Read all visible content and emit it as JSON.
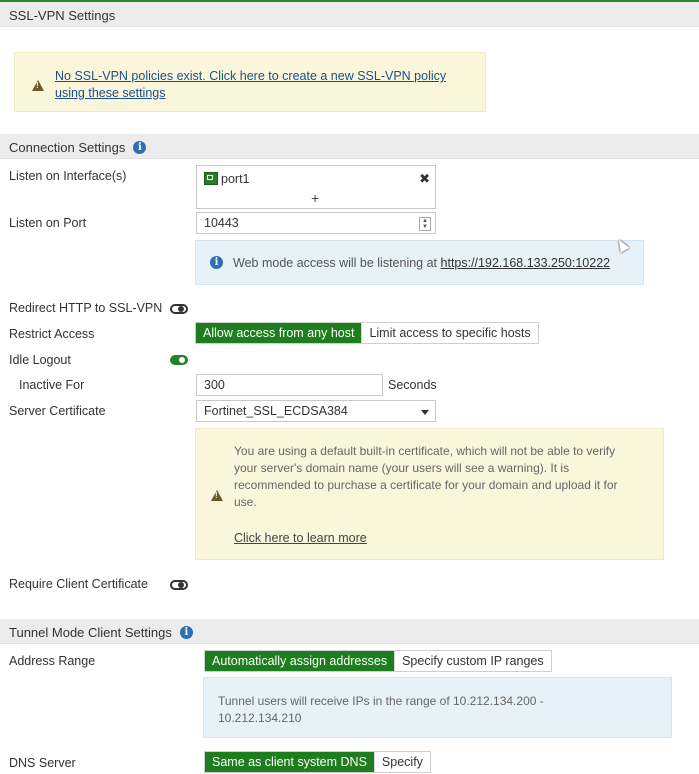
{
  "page": {
    "section_ssl": "SSL-VPN Settings",
    "policy_warning_line1": "No SSL-VPN policies exist. Click here to create a new SSL-VPN policy",
    "policy_warning_line2": "using these settings",
    "section_connection": "Connection Settings",
    "section_tunnel": "Tunnel Mode Client Settings"
  },
  "connection": {
    "listen_interface_label": "Listen on Interface(s)",
    "interface_item": "port1",
    "add_symbol": "+",
    "remove_symbol": "✖",
    "listen_port_label": "Listen on Port",
    "listen_port_value": "10443",
    "web_mode_text": "Web mode access will be listening at ",
    "web_mode_link": "https://192.168.133.250:10222",
    "redirect_label": "Redirect HTTP to SSL-VPN",
    "redirect_on": false,
    "restrict_label": "Restrict Access",
    "restrict_options": [
      "Allow access from any host",
      "Limit access to specific hosts"
    ],
    "idle_logout_label": "Idle Logout",
    "idle_logout_on": true,
    "inactive_for_label": "Inactive For",
    "inactive_for_value": "300",
    "inactive_for_unit": "Seconds",
    "server_cert_label": "Server Certificate",
    "server_cert_value": "Fortinet_SSL_ECDSA384",
    "cert_warning_line1": "You are using a default built-in certificate, which will not be able to verify",
    "cert_warning_line2": "your server's domain name (your users will see a warning). It is",
    "cert_warning_line3": "recommended to purchase a certificate for your domain and upload it for",
    "cert_warning_line4": "use.",
    "learn_more": "Click here to learn more",
    "require_cert_label": "Require Client Certificate",
    "require_cert_on": false
  },
  "tunnel": {
    "address_range_label": "Address Range",
    "address_range_options": [
      "Automatically assign addresses",
      "Specify custom IP ranges"
    ],
    "range_info_line1": "Tunnel users will receive IPs in the range of 10.212.134.200 -",
    "range_info_line2": "10.212.134.210",
    "dns_label": "DNS Server",
    "dns_options": [
      "Same as client system DNS",
      "Specify"
    ]
  },
  "colors": {
    "accent_green": "#1e7d1e",
    "info_blue": "#2b6fb4",
    "warning_bg": "#faf6dc",
    "info_bg": "#e6f1f8"
  }
}
